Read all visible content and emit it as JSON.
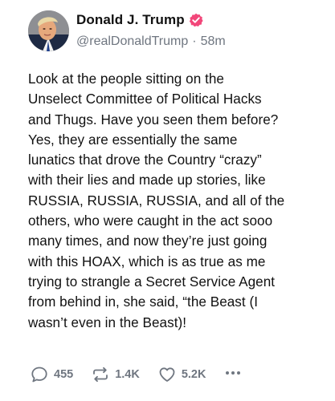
{
  "post": {
    "author": {
      "display_name": "Donald J. Trump",
      "handle": "@realDonaldTrump",
      "verified": true,
      "verified_color": "#f2477a"
    },
    "time_ago": "58m",
    "separator": "·",
    "text": "Look at the people sitting on the\nUnselect Committee of Political Hacks\nand Thugs. Have you seen them before?\nYes, they are essentially the same\nlunatics that drove the Country “crazy”\nwith their lies and made up stories, like\nRUSSIA, RUSSIA, RUSSIA, and all of the\nothers, who were caught in the act sooo\nmany times, and now they’re just going\nwith this HOAX, which is as true as me\ntrying to strangle a Secret Service Agent\nfrom behind in, she said, “the Beast (I\nwasn’t even in the Beast)!",
    "actions": {
      "replies": "455",
      "reposts": "1.4K",
      "likes": "5.2K"
    },
    "icons": {
      "reply": "reply-bubble-icon",
      "repost": "repost-arrows-icon",
      "like": "heart-icon",
      "more": "more-dots-icon"
    },
    "muted_color": "#6f7680"
  }
}
